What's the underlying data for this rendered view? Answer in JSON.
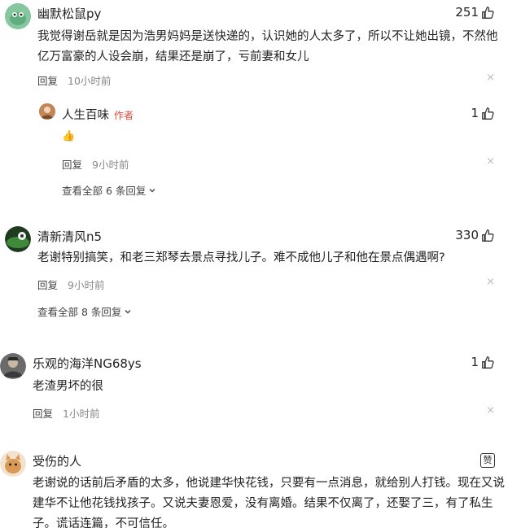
{
  "comments": [
    {
      "username": "幽默松鼠py",
      "likes": "251",
      "content": "我觉得谢岳就是因为浩男妈妈是送快递的，认识她的人太多了，所以不让她出镜，不然他亿万富豪的人设会崩，结果还是崩了，亏前妻和女儿",
      "reply_label": "回复",
      "time": "10小时前",
      "close": "×",
      "replies": [
        {
          "username": "人生百味",
          "badge": "作者",
          "likes": "1",
          "content": "👍",
          "reply_label": "回复",
          "time": "9小时前",
          "close": "×"
        }
      ],
      "expand_label": "查看全部 6 条回复"
    },
    {
      "username": "清新清风n5",
      "likes": "330",
      "content": "老谢特别搞笑，和老三郑琴去景点寻找儿子。难不成他儿子和他在景点偶遇啊?",
      "reply_label": "回复",
      "time": "9小时前",
      "close": "×",
      "expand_label": "查看全部 8 条回复"
    },
    {
      "username": "乐观的海洋NG68ys",
      "likes": "1",
      "content": "老渣男坏的很",
      "reply_label": "回复",
      "time": "1小时前",
      "close": "×"
    },
    {
      "username": "受伤的人",
      "praise_label": "赞",
      "content": "老谢说的话前后矛盾的太多，他说建华快花钱，只要有一点消息，就给别人打钱。现在又说建华不让他花钱找孩子。又说夫妻恩爱，没有离婚。结果不仅离了，还娶了三，有了私生子。谎话连篇，不可信任。"
    }
  ],
  "colors": {
    "badge": "#e8483a",
    "muted": "#888888",
    "text": "#222222"
  }
}
